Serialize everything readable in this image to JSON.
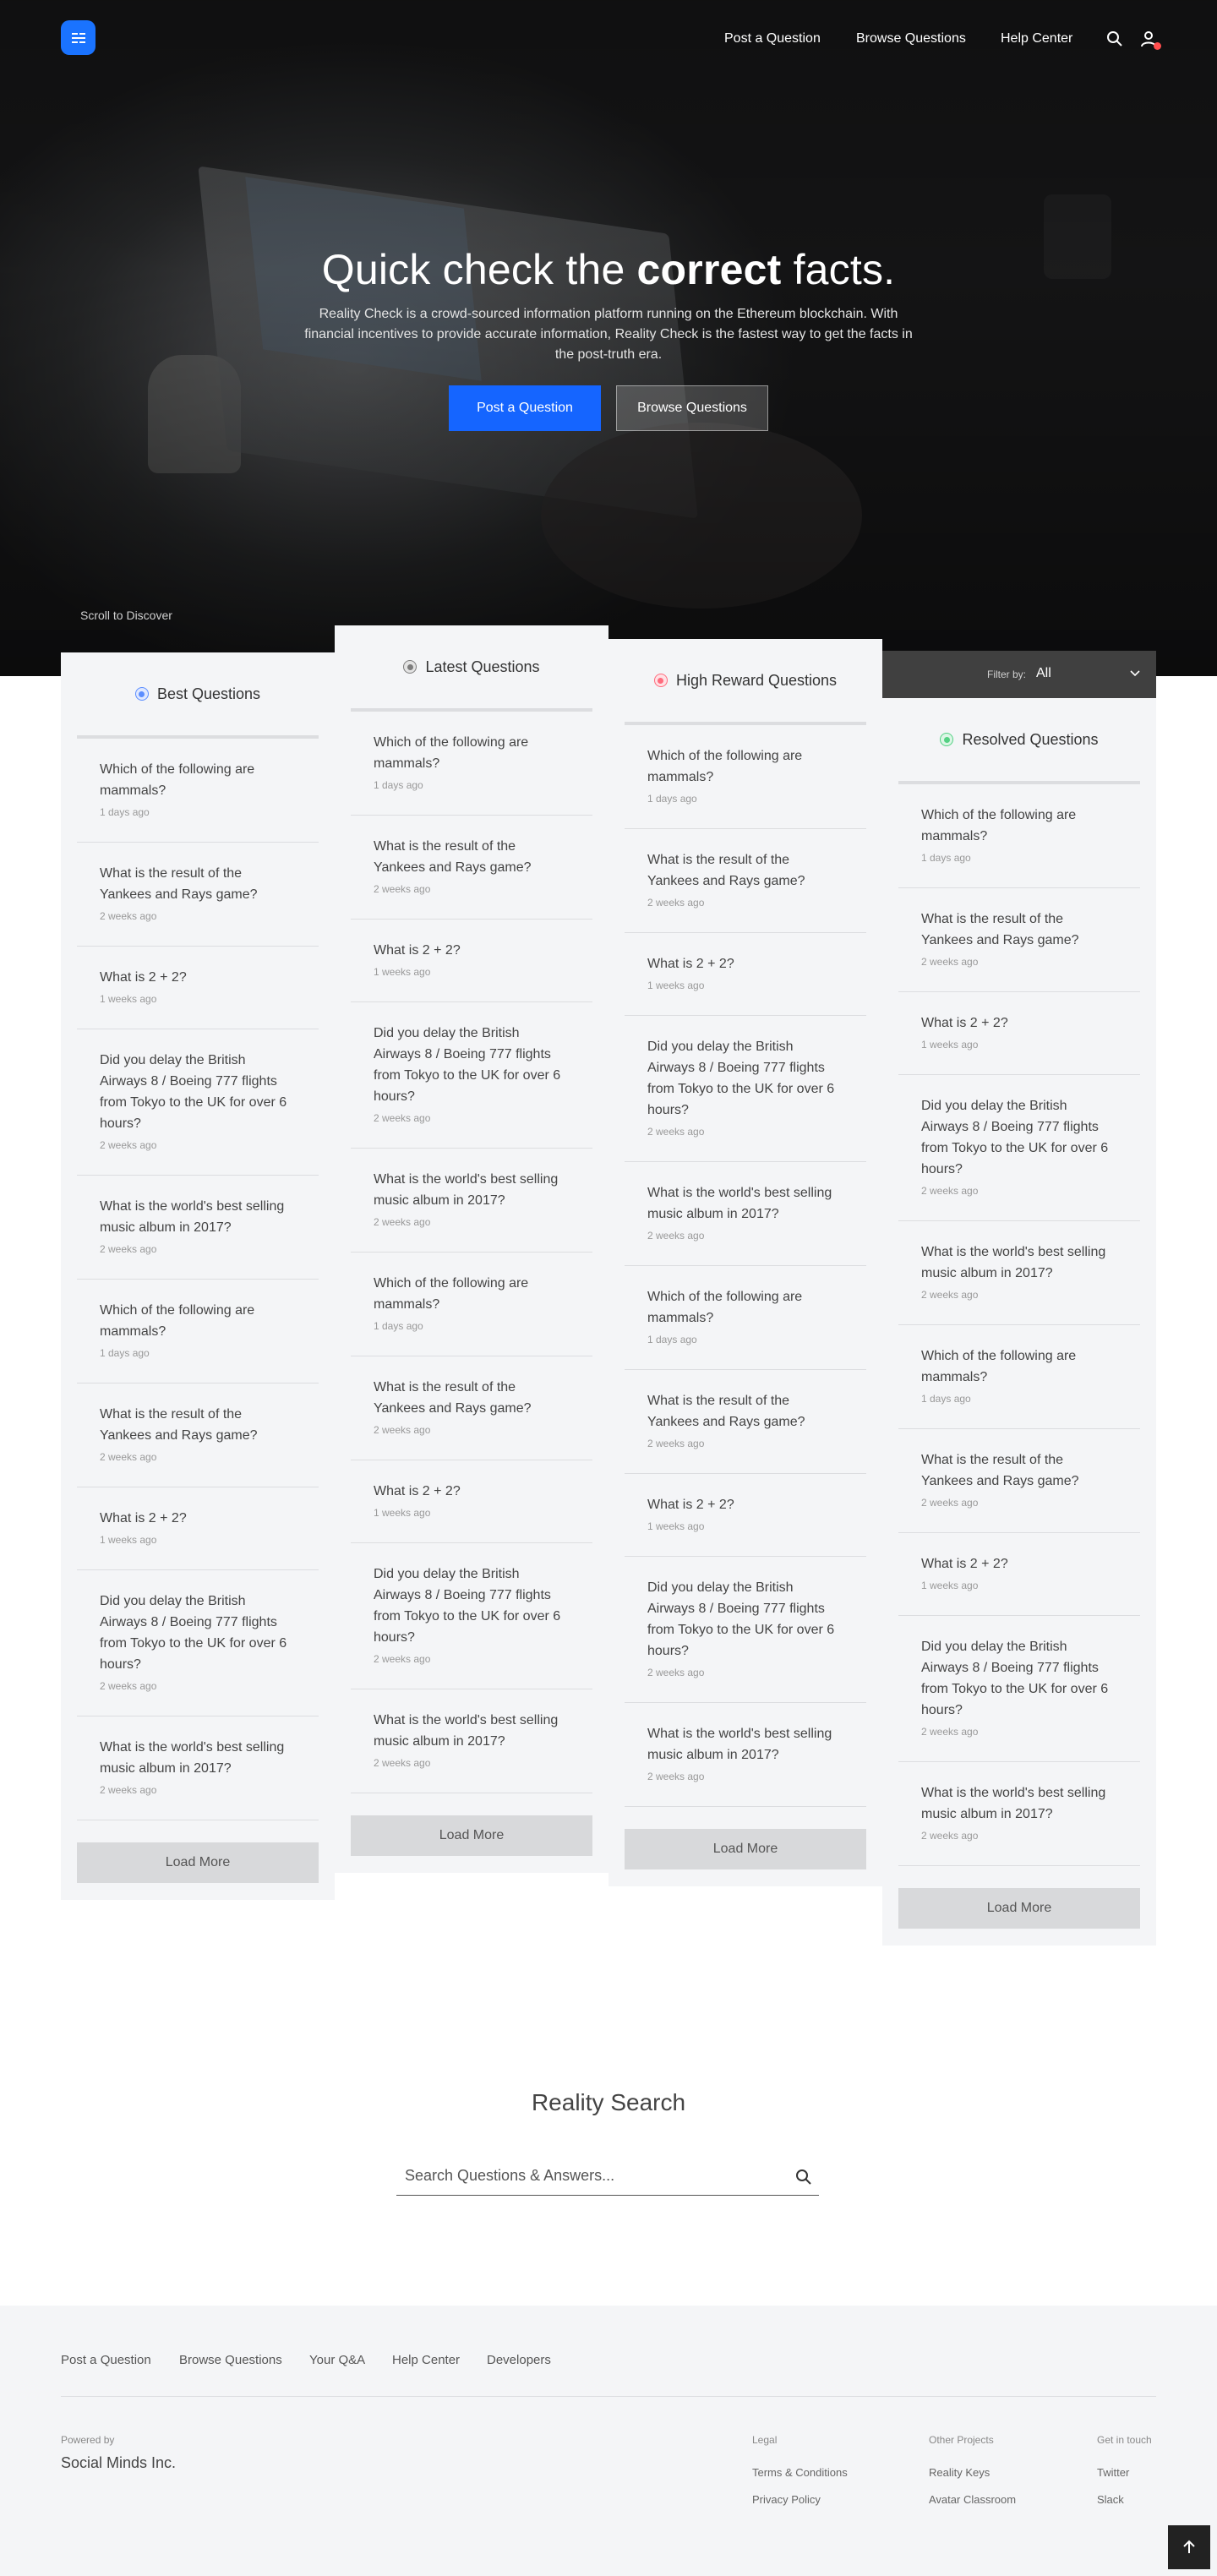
{
  "nav": {
    "links": [
      "Post a Question",
      "Browse Questions",
      "Help Center"
    ],
    "logo_icon": "reality-check-logo"
  },
  "hero": {
    "title_pre": "Quick check the ",
    "title_bold": "correct",
    "title_post": " facts.",
    "description": "Reality Check is a crowd-sourced information platform running on the Ethereum blockchain. With financial incentives to provide accurate information, Reality Check is the fastest way to get the facts in the post-truth era.",
    "primary_button": "Post a Question",
    "secondary_button": "Browse Questions",
    "scroll_hint": "Scroll to Discover"
  },
  "filter": {
    "label": "Filter by:",
    "value": "All"
  },
  "colors": {
    "accent": "#1565ff",
    "best": "#5b8dff",
    "latest": "#7d7d7d",
    "high_reward": "#ff6b7d",
    "resolved": "#54d183"
  },
  "columns": [
    {
      "title": "Best Questions",
      "load_more": "Load More",
      "items": [
        {
          "text": "Which of the following are mammals?",
          "time": "1 days ago"
        },
        {
          "text": "What is the result of the Yankees and Rays game?",
          "time": "2 weeks ago"
        },
        {
          "text": "What is 2 + 2?",
          "time": "1 weeks ago"
        },
        {
          "text": "Did you delay the British Airways 8 / Boeing 777 flights from Tokyo to the UK for over 6 hours?",
          "time": "2 weeks ago"
        },
        {
          "text": "What is the world's best selling music album in 2017?",
          "time": "2 weeks ago"
        },
        {
          "text": "Which of the following are mammals?",
          "time": "1 days ago"
        },
        {
          "text": "What is the result of the Yankees and Rays game?",
          "time": "2 weeks ago"
        },
        {
          "text": "What is 2 + 2?",
          "time": "1 weeks ago"
        },
        {
          "text": "Did you delay the British Airways 8 / Boeing 777 flights from Tokyo to the UK for over 6 hours?",
          "time": "2 weeks ago"
        },
        {
          "text": "What is the world's best selling music album in 2017?",
          "time": "2 weeks ago"
        }
      ]
    },
    {
      "title": "Latest Questions",
      "load_more": "Load More",
      "items": [
        {
          "text": "Which of the following are mammals?",
          "time": "1 days ago"
        },
        {
          "text": "What is the result of the Yankees and Rays game?",
          "time": "2 weeks ago"
        },
        {
          "text": "What is 2 + 2?",
          "time": "1 weeks ago"
        },
        {
          "text": "Did you delay the British Airways 8 / Boeing 777 flights from Tokyo to the UK for over 6 hours?",
          "time": "2 weeks ago"
        },
        {
          "text": "What is the world's best selling music album in 2017?",
          "time": "2 weeks ago"
        },
        {
          "text": "Which of the following are mammals?",
          "time": "1 days ago"
        },
        {
          "text": "What is the result of the Yankees and Rays game?",
          "time": "2 weeks ago"
        },
        {
          "text": "What is 2 + 2?",
          "time": "1 weeks ago"
        },
        {
          "text": "Did you delay the British Airways 8 / Boeing 777 flights from Tokyo to the UK for over 6 hours?",
          "time": "2 weeks ago"
        },
        {
          "text": "What is the world's best selling music album in 2017?",
          "time": "2 weeks ago"
        }
      ]
    },
    {
      "title": "High Reward Questions",
      "load_more": "Load More",
      "items": [
        {
          "text": "Which of the following are mammals?",
          "time": "1 days ago"
        },
        {
          "text": "What is the result of the Yankees and Rays game?",
          "time": "2 weeks ago"
        },
        {
          "text": "What is 2 + 2?",
          "time": "1 weeks ago"
        },
        {
          "text": "Did you delay the British Airways 8 / Boeing 777 flights from Tokyo to the UK for over 6 hours?",
          "time": "2 weeks ago"
        },
        {
          "text": "What is the world's best selling music album in 2017?",
          "time": "2 weeks ago"
        },
        {
          "text": "Which of the following are mammals?",
          "time": "1 days ago"
        },
        {
          "text": "What is the result of the Yankees and Rays game?",
          "time": "2 weeks ago"
        },
        {
          "text": "What is 2 + 2?",
          "time": "1 weeks ago"
        },
        {
          "text": "Did you delay the British Airways 8 / Boeing 777 flights from Tokyo to the UK for over 6 hours?",
          "time": "2 weeks ago"
        },
        {
          "text": "What is the world's best selling music album in 2017?",
          "time": "2 weeks ago"
        }
      ]
    },
    {
      "title": "Resolved Questions",
      "load_more": "Load More",
      "items": [
        {
          "text": "Which of the following are mammals?",
          "time": "1 days ago"
        },
        {
          "text": "What is the result of the Yankees and Rays game?",
          "time": "2 weeks ago"
        },
        {
          "text": "What is 2 + 2?",
          "time": "1 weeks ago"
        },
        {
          "text": "Did you delay the British Airways 8 / Boeing 777 flights from Tokyo to the UK for over 6 hours?",
          "time": "2 weeks ago"
        },
        {
          "text": "What is the world's best selling music album in 2017?",
          "time": "2 weeks ago"
        },
        {
          "text": "Which of the following are mammals?",
          "time": "1 days ago"
        },
        {
          "text": "What is the result of the Yankees and Rays game?",
          "time": "2 weeks ago"
        },
        {
          "text": "What is 2 + 2?",
          "time": "1 weeks ago"
        },
        {
          "text": "Did you delay the British Airways 8 / Boeing 777 flights from Tokyo to the UK for over 6 hours?",
          "time": "2 weeks ago"
        },
        {
          "text": "What is the world's best selling music album in 2017?",
          "time": "2 weeks ago"
        }
      ]
    }
  ],
  "search": {
    "title": "Reality Search",
    "placeholder": "Search Questions & Answers..."
  },
  "footer": {
    "links": [
      "Post a Question",
      "Browse Questions",
      "Your Q&A",
      "Help Center",
      "Developers"
    ],
    "powered_by": "Powered by",
    "company": "Social Minds Inc.",
    "groups": [
      {
        "heading": "Legal",
        "items": [
          "Terms & Conditions",
          "Privacy Policy"
        ]
      },
      {
        "heading": "Other Projects",
        "items": [
          "Reality Keys",
          "Avatar Classroom"
        ]
      },
      {
        "heading": "Get in touch",
        "items": [
          "Twitter",
          "Slack"
        ]
      }
    ]
  }
}
